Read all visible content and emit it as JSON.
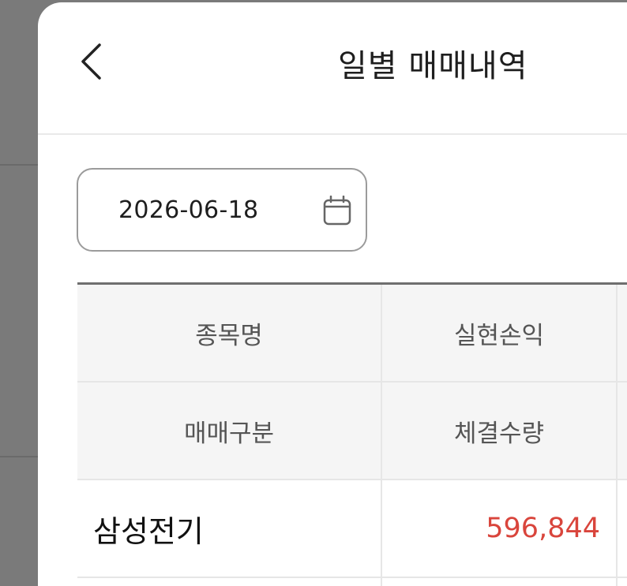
{
  "header": {
    "back_icon": "chevron-left-icon",
    "title": "일별 매매내역"
  },
  "date_picker": {
    "value": "2026-06-18",
    "icon": "calendar-icon"
  },
  "table": {
    "header_rows": [
      [
        "종목명",
        "실현손익"
      ],
      [
        "매매구분",
        "체결수량"
      ]
    ],
    "rows": [
      {
        "name": "삼성전기",
        "realized_pnl": "596,844",
        "pnl_color": "#d9453c"
      }
    ]
  },
  "colors": {
    "backdrop": "#7a7a7a",
    "profit_red": "#d9453c",
    "header_bg": "#f5f5f5"
  }
}
